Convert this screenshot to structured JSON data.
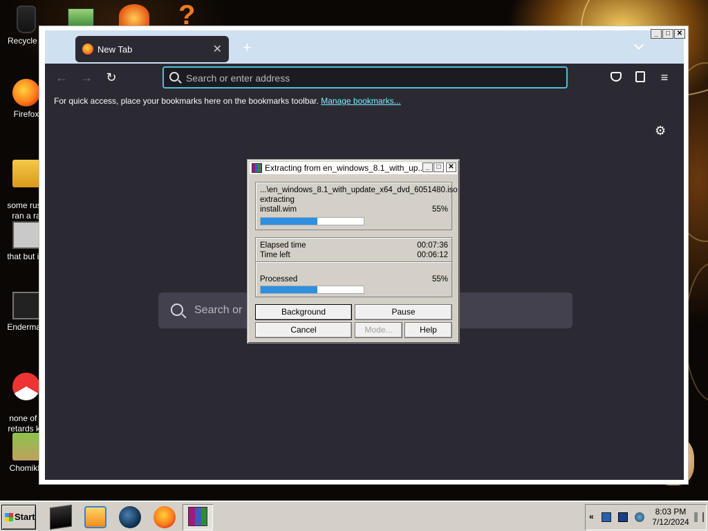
{
  "desktop": {
    "icons": [
      {
        "label": "Recycle B",
        "icon": "recycle-bin-icon"
      },
      {
        "label": "Firefox",
        "icon": "firefox-icon"
      },
      {
        "label": "some russ\nran a ra",
        "icon": "folder-icon"
      },
      {
        "label": "that but its",
        "icon": "stack-icon"
      },
      {
        "label": "Enderman",
        "icon": "terminal-icon"
      },
      {
        "label": "none of y\nretards kn",
        "icon": "chrome-icon"
      },
      {
        "label": "ChomikB",
        "icon": "chomik-icon"
      }
    ]
  },
  "browser": {
    "tab_title": "New Tab",
    "tab_close": "✕",
    "new_tab": "+",
    "url_placeholder": "Search or enter address",
    "bookmarks_text": "For quick access, place your bookmarks here on the bookmarks toolbar.",
    "manage_bookmarks": "Manage bookmarks...",
    "search_placeholder": "Search or enter address"
  },
  "rar_dialog": {
    "title": "Extracting from en_windows_8.1_with_up...",
    "archive": "...\\en_windows_8.1_with_update_x64_dvd_6051480.iso",
    "action": "extracting",
    "file": "install.wim",
    "file_percent": "55%",
    "file_progress": 0.55,
    "elapsed_label": "Elapsed time",
    "elapsed_value": "00:07:36",
    "left_label": "Time left",
    "left_value": "00:06:12",
    "processed_label": "Processed",
    "processed_percent": "55%",
    "processed_progress": 0.55,
    "buttons": {
      "background": "Background",
      "pause": "Pause",
      "cancel": "Cancel",
      "mode": "Mode...",
      "help": "Help"
    }
  },
  "taskbar": {
    "start_label": "Start",
    "tray_arrow": "«",
    "time": "8:03 PM",
    "date": "7/12/2024"
  },
  "colors": {
    "progress": "#2f8fe0",
    "firefox_bg": "#2b2a33",
    "urlbar_focus": "#4fbfd8",
    "link": "#80ebff"
  }
}
